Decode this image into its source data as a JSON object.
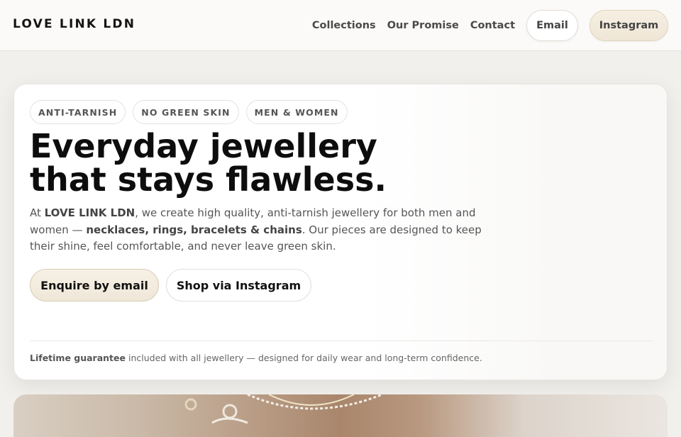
{
  "header": {
    "brand": "LOVE LINK LDN",
    "nav": [
      "Collections",
      "Our Promise",
      "Contact"
    ],
    "email_button": "Email",
    "instagram_button": "Instagram"
  },
  "hero": {
    "badges": [
      "ANTI-TARNISH",
      "NO GREEN SKIN",
      "MEN & WOMEN"
    ],
    "headline_line1": "Everyday jewellery",
    "headline_line2": "that stays flawless.",
    "intro": {
      "part1": "At ",
      "brand": "LOVE LINK LDN",
      "part2": ", we create high quality, anti-tarnish jewellery for both men and women — ",
      "highlight": "necklaces, rings, bracelets & chains",
      "part3": ". Our pieces are designed to keep their shine, feel comfortable, and never leave green skin."
    },
    "cta_primary": "Enquire by email",
    "cta_secondary": "Shop via Instagram",
    "guarantee_bold": "Lifetime guarantee",
    "guarantee_rest": " included with all jewellery — designed for daily wear and long-term confidence."
  },
  "photo": {
    "icon": "jewellery-photo"
  }
}
